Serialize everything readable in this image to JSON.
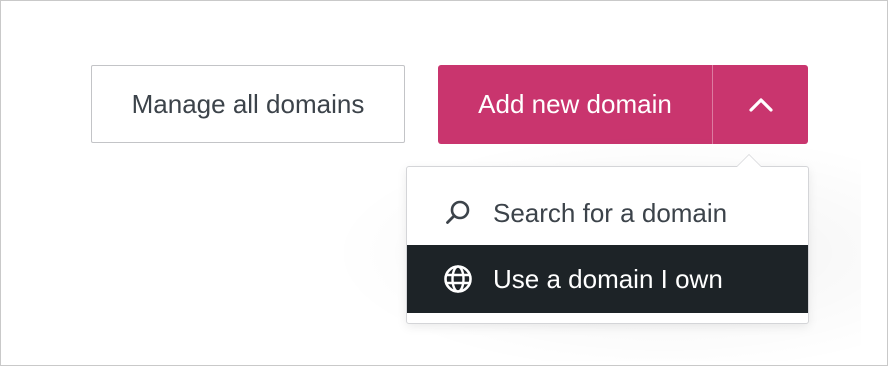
{
  "actions": {
    "manage_label": "Manage all domains",
    "add_label": "Add new domain",
    "toggle_icon": "chevron-up-icon"
  },
  "dropdown": {
    "items": [
      {
        "label": "Search for a domain",
        "icon": "search-icon",
        "highlighted": false
      },
      {
        "label": "Use a domain I own",
        "icon": "globe-icon",
        "highlighted": true
      }
    ]
  },
  "colors": {
    "accent": "#c9356e",
    "highlight": "#1d2327",
    "text": "#3c434a",
    "border": "#c3c4c7"
  }
}
